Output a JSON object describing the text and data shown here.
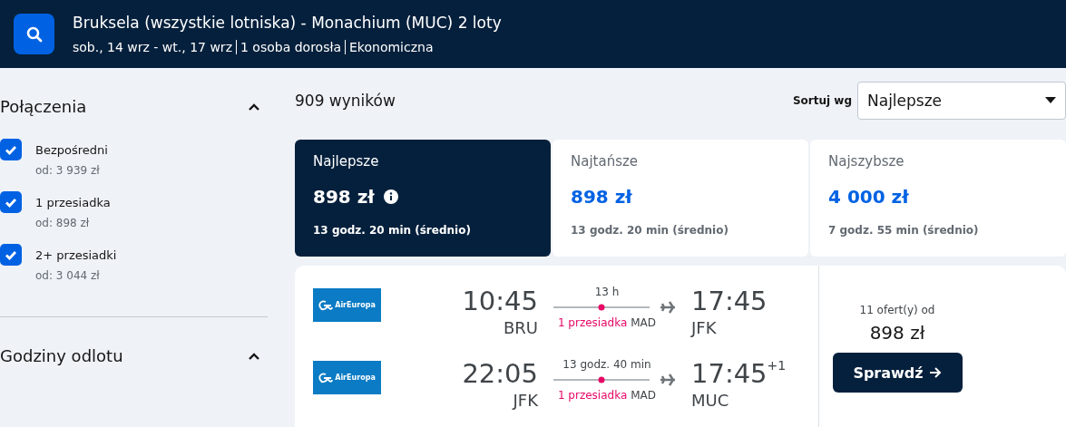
{
  "header": {
    "title": "Bruksela (wszystkie lotniska) - Monachium (MUC) 2 loty",
    "details": [
      "sob., 14 wrz - wt., 17 wrz",
      "1 osoba dorosła",
      "Ekonomiczna"
    ]
  },
  "filters": [
    {
      "title": "Połączenia",
      "expanded": true,
      "options": [
        {
          "label": "Bezpośredni",
          "price": "od: 3 939 zł",
          "checked": true
        },
        {
          "label": "1 przesiadka",
          "price": "od: 898 zł",
          "checked": true
        },
        {
          "label": "2+ przesiadki",
          "price": "od: 3 044 zł",
          "checked": true
        }
      ]
    },
    {
      "title": "Godziny odlotu",
      "expanded": true
    }
  ],
  "results_count": "909 wyników",
  "sort": {
    "label": "Sortuj wg",
    "value": "Najlepsze"
  },
  "summary_tabs": [
    {
      "label": "Najlepsze",
      "price": "898 zł",
      "duration": "13 godz. 20 min (średnio)",
      "selected": true,
      "info": true
    },
    {
      "label": "Najtańsze",
      "price": "898 zł",
      "duration": "13 godz. 20 min (średnio)",
      "selected": false,
      "info": false
    },
    {
      "label": "Najszybsze",
      "price": "4 000 zł",
      "duration": "7 godz. 55 min (średnio)",
      "selected": false,
      "info": false
    }
  ],
  "result": {
    "legs": [
      {
        "airline": "AirEuropa",
        "depart_time": "10:45",
        "depart_airport": "BRU",
        "duration": "13 h",
        "stops": "1 przesiadka",
        "via": "MAD",
        "arrive_time": "17:45",
        "arrive_airport": "JFK"
      },
      {
        "airline": "AirEuropa",
        "depart_time": "22:05",
        "depart_airport": "JFK",
        "duration": "13 godz. 40 min",
        "stops": "1 przesiadka",
        "via": "MAD",
        "arrive_time": "17:45",
        "day_offset": "+1",
        "arrive_airport": "MUC"
      }
    ],
    "offers": "11 ofert(y) od",
    "price": "898 zł",
    "button": "Sprawdź"
  }
}
